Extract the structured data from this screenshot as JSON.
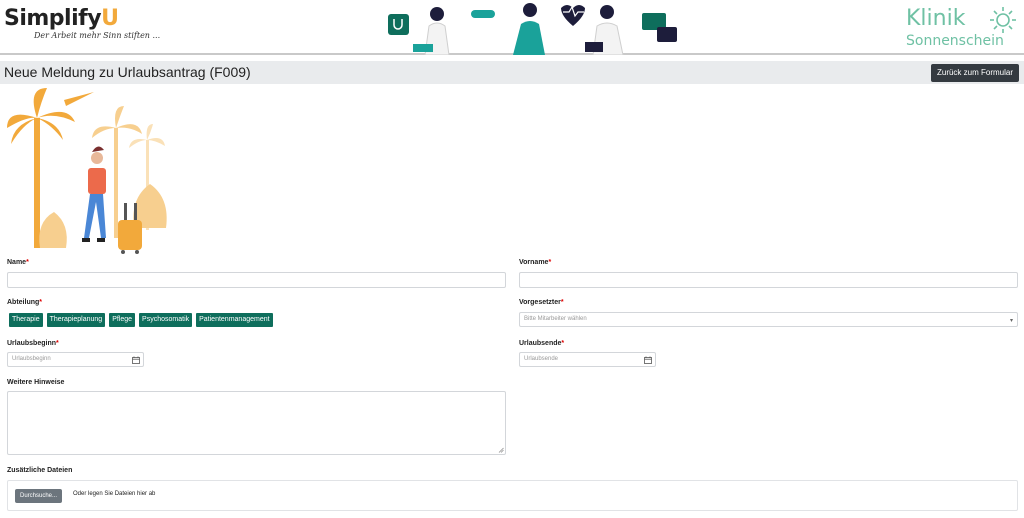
{
  "header": {
    "logo_text": "Simplify",
    "logo_accent": "U",
    "logo_tagline": "Der Arbeit mehr Sinn stiften ...",
    "klinik_line1": "Klinik",
    "klinik_line2": "Sonnenschein"
  },
  "page": {
    "title": "Neue Meldung zu Urlaubsantrag (F009)",
    "back_button": "Zurück zum Formular"
  },
  "form": {
    "name_label": "Name",
    "vorname_label": "Vorname",
    "abteilung_label": "Abteilung",
    "vorgesetzter_label": "Vorgesetzter",
    "vorgesetzter_placeholder": "Bitte Mitarbeiter wählen",
    "urlaubsbeginn_label": "Urlaubsbeginn",
    "urlaubsbeginn_placeholder": "Urlaubsbeginn",
    "urlaubsende_label": "Urlaubsende",
    "urlaubsende_placeholder": "Urlaubsende",
    "hinweise_label": "Weitere Hinweise",
    "dateien_label": "Zusätzliche Dateien",
    "browse_button": "Durchsuche...",
    "drop_text": "Oder legen Sie Dateien hier ab",
    "required_marker": "*",
    "departments": [
      "Therapie",
      "Therapieplanung",
      "Pflege",
      "Psychosomatik",
      "Patientenmanagement"
    ]
  },
  "colors": {
    "accent": "#0e6e5c",
    "logo_orange": "#f2a93b",
    "klinik_green": "#6fc1a4",
    "required": "#dd0000"
  }
}
